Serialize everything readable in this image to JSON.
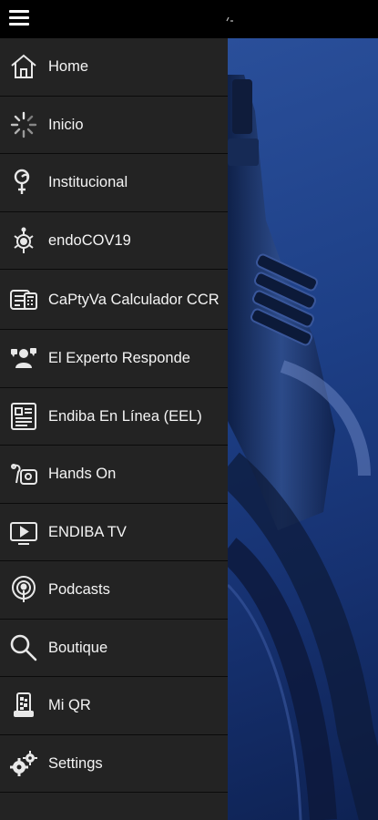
{
  "menu": {
    "items": [
      {
        "label": "Home",
        "icon": "home-icon"
      },
      {
        "label": "Inicio",
        "icon": "loading-icon"
      },
      {
        "label": "Institucional",
        "icon": "institutional-icon"
      },
      {
        "label": "endoCOV19",
        "icon": "virus-icon"
      },
      {
        "label": "CaPtyVa Calculador CCR",
        "icon": "calculator-icon"
      },
      {
        "label": "El Experto Responde",
        "icon": "expert-icon"
      },
      {
        "label": "Endiba En Línea (EEL)",
        "icon": "document-icon"
      },
      {
        "label": "Hands On",
        "icon": "endoscope-icon"
      },
      {
        "label": "ENDIBA TV",
        "icon": "tv-icon"
      },
      {
        "label": "Podcasts",
        "icon": "podcast-icon"
      },
      {
        "label": "Boutique",
        "icon": "search-icon"
      },
      {
        "label": "Mi QR",
        "icon": "qr-icon"
      },
      {
        "label": "Settings",
        "icon": "gears-icon"
      }
    ]
  },
  "colors": {
    "drawer": "#232323",
    "divider": "#0b0b0b",
    "hero": "#1d3f86",
    "text": "#f4f4f4"
  }
}
